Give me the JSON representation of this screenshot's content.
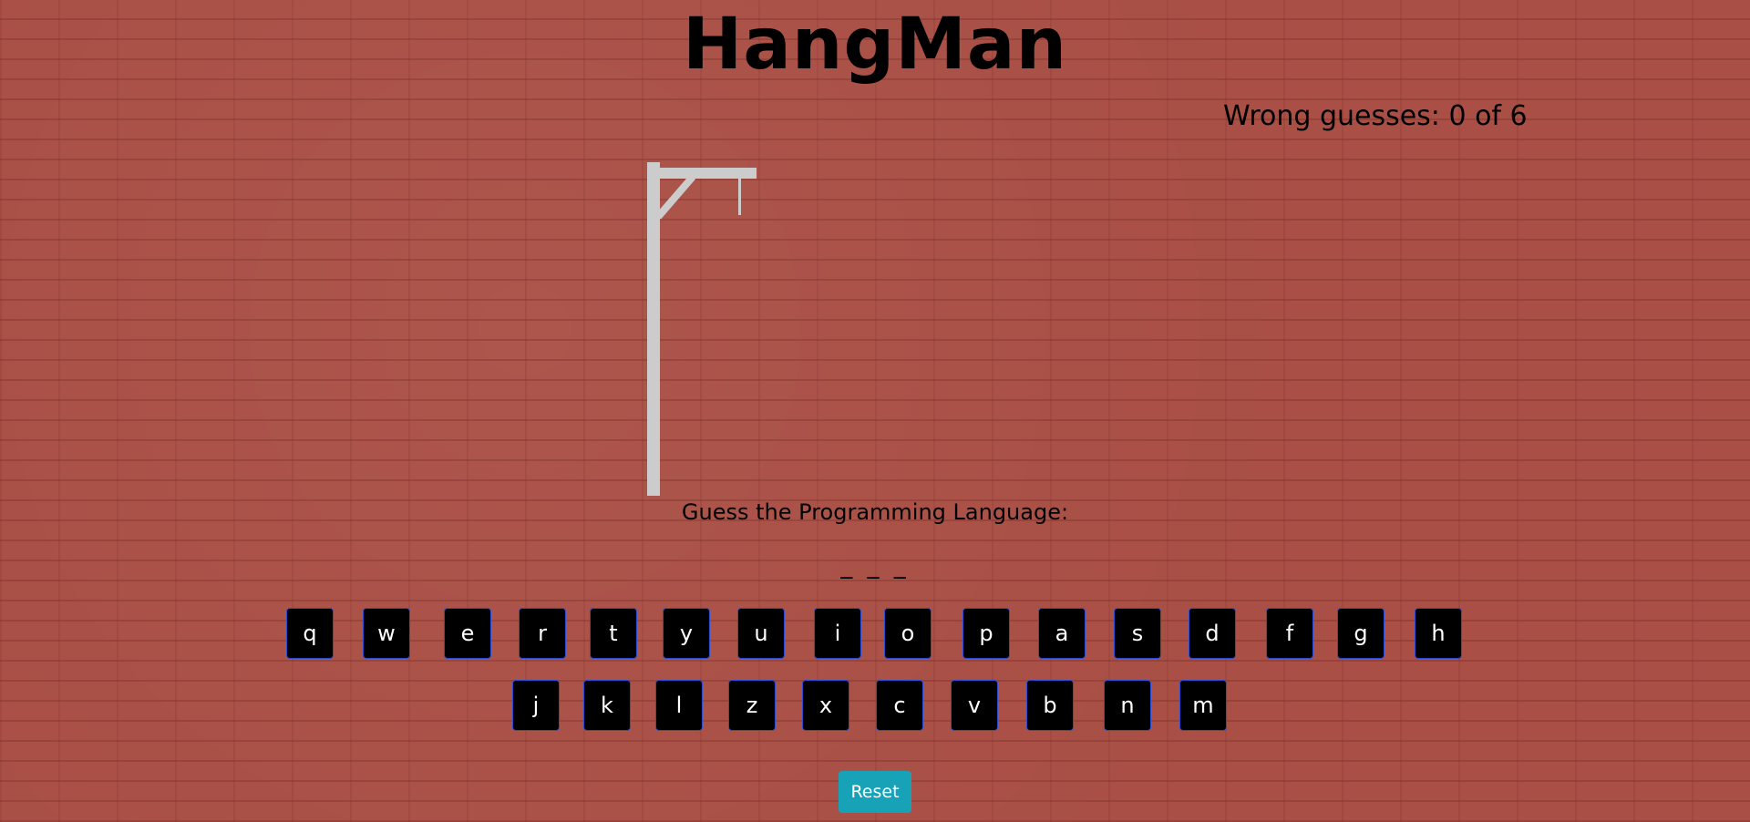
{
  "title": "HangMan",
  "status": {
    "wrong_guesses": "Wrong guesses: 0 of 6",
    "wrong_count": 0,
    "max_wrong": 6
  },
  "prompt": "Guess the Programming Language:",
  "word_display": "_ _ _",
  "keyboard": {
    "row1": [
      "q",
      "w",
      "e",
      "r",
      "t",
      "y",
      "u",
      "i",
      "o",
      "p",
      "a",
      "s",
      "d",
      "f",
      "g",
      "h"
    ],
    "row2": [
      "j",
      "k",
      "l",
      "z",
      "x",
      "c",
      "v",
      "b",
      "n",
      "m"
    ]
  },
  "reset_label": "Reset",
  "colors": {
    "background": "#a94f45",
    "key_bg": "#000000",
    "key_border": "#2a4dd8",
    "reset_bg": "#17a2b8",
    "gallows": "#cccccc"
  }
}
